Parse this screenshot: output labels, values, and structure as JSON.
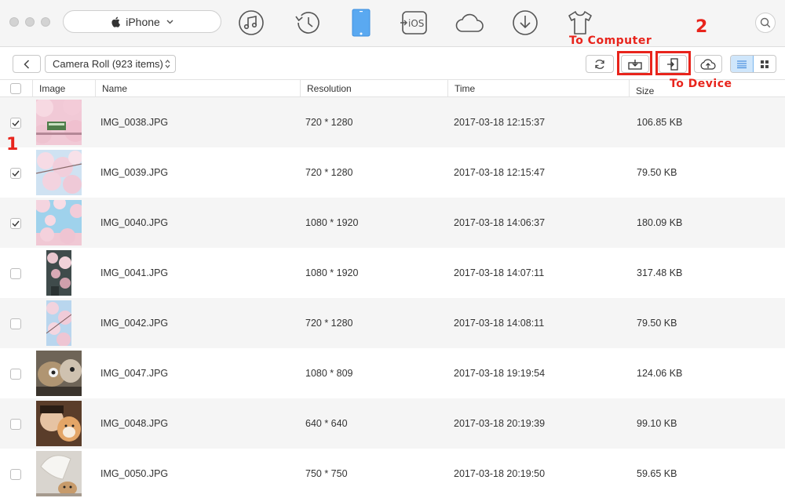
{
  "device": {
    "name": "iPhone"
  },
  "nav_icons": [
    "music-icon",
    "history-icon",
    "phone-icon",
    "ios-transfer-icon",
    "cloud-icon",
    "download-icon",
    "tshirt-icon"
  ],
  "album": {
    "label": "Camera Roll (923 items)"
  },
  "annotations": {
    "to_computer": "To Computer",
    "to_device": "To Device",
    "step1": "1",
    "step2": "2",
    "highlight_color": "#e8241c"
  },
  "table": {
    "headers": {
      "image": "Image",
      "name": "Name",
      "resolution": "Resolution",
      "time": "Time",
      "size": "Size"
    },
    "rows": [
      {
        "name": "IMG_0038.JPG",
        "resolution": "720 * 1280",
        "time": "2017-03-18 12:15:37",
        "size": "106.85 KB",
        "checked": true,
        "thumb": "sakura-train"
      },
      {
        "name": "IMG_0039.JPG",
        "resolution": "720 * 1280",
        "time": "2017-03-18 12:15:47",
        "size": "79.50 KB",
        "checked": true,
        "thumb": "sakura-blossoms"
      },
      {
        "name": "IMG_0040.JPG",
        "resolution": "1080 * 1920",
        "time": "2017-03-18 14:06:37",
        "size": "180.09 KB",
        "checked": true,
        "thumb": "sakura-sky"
      },
      {
        "name": "IMG_0041.JPG",
        "resolution": "1080 * 1920",
        "time": "2017-03-18 14:07:11",
        "size": "317.48 KB",
        "checked": false,
        "thumb": "sakura-dark"
      },
      {
        "name": "IMG_0042.JPG",
        "resolution": "720 * 1280",
        "time": "2017-03-18 14:08:11",
        "size": "79.50 KB",
        "checked": false,
        "thumb": "sakura-portrait"
      },
      {
        "name": "IMG_0047.JPG",
        "resolution": "1080 * 809",
        "time": "2017-03-18 19:19:54",
        "size": "124.06 KB",
        "checked": false,
        "thumb": "cats"
      },
      {
        "name": "IMG_0048.JPG",
        "resolution": "640 * 640",
        "time": "2017-03-18 20:19:39",
        "size": "99.10 KB",
        "checked": false,
        "thumb": "selfie-dog"
      },
      {
        "name": "IMG_0050.JPG",
        "resolution": "750 * 750",
        "time": "2017-03-18 20:19:50",
        "size": "59.65 KB",
        "checked": false,
        "thumb": "lamp-dog"
      }
    ]
  }
}
